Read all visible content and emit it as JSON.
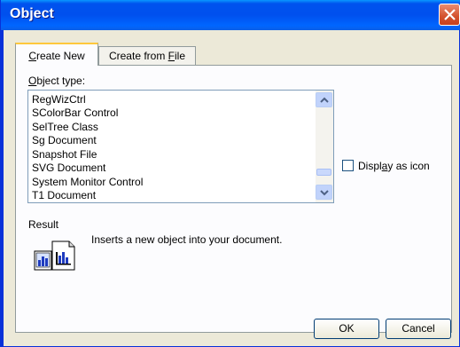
{
  "window": {
    "title": "Object"
  },
  "tabs": {
    "create_new": {
      "pre": "",
      "key": "C",
      "post": "reate New"
    },
    "create_from_file": {
      "pre": "Create from ",
      "key": "F",
      "post": "ile"
    }
  },
  "object_type": {
    "label_key": "O",
    "label_rest": "bject type:",
    "items": [
      "RegWizCtrl",
      "SColorBar Control",
      "SelTree Class",
      "Sg Document",
      "Snapshot File",
      "SVG Document",
      "System Monitor Control",
      "T1 Document"
    ]
  },
  "display_as_icon": {
    "pre": "Displ",
    "key": "a",
    "post": "y as icon",
    "checked": false
  },
  "result": {
    "label": "Result",
    "text": "Inserts a new  object into your document."
  },
  "buttons": {
    "ok": "OK",
    "cancel": "Cancel"
  },
  "icons": {
    "close": "close-icon",
    "scroll_up": "chevron-up-icon",
    "scroll_down": "chevron-down-icon",
    "result": "document-chart-icon"
  },
  "colors": {
    "titlebar": "#0054e3",
    "close": "#d3512d",
    "dialog_bg": "#ece9d8",
    "tab_highlight": "#ffc83c"
  }
}
